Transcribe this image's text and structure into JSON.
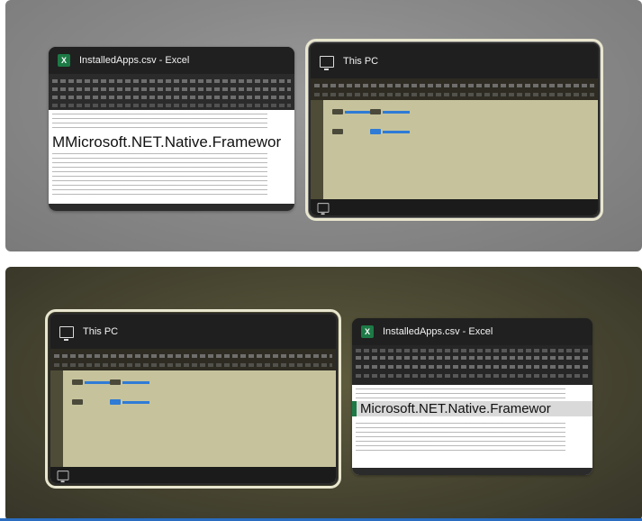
{
  "top_switcher": {
    "windows": [
      {
        "title": "InstalledApps.csv - Excel",
        "app": "excel",
        "icon": "excel-icon",
        "selected": false,
        "preview_text": "Microsoft.NET.Native.Framewor",
        "cell_prefix": "M"
      },
      {
        "title": "This PC",
        "app": "file-explorer",
        "icon": "computer-icon",
        "selected": true
      }
    ]
  },
  "bottom_switcher": {
    "windows": [
      {
        "title": "This PC",
        "app": "file-explorer",
        "icon": "computer-icon",
        "selected": true
      },
      {
        "title": "InstalledApps.csv - Excel",
        "app": "excel",
        "icon": "excel-icon",
        "selected": false,
        "preview_text": "Microsoft.NET.Native.Framewor"
      }
    ]
  },
  "colors": {
    "top_background": "#8a8a8a",
    "bottom_background": "#4a4832",
    "selection_outline": "#e9e6cf",
    "excel_green": "#1d7a46",
    "explorer_content": "#c6c39c"
  }
}
